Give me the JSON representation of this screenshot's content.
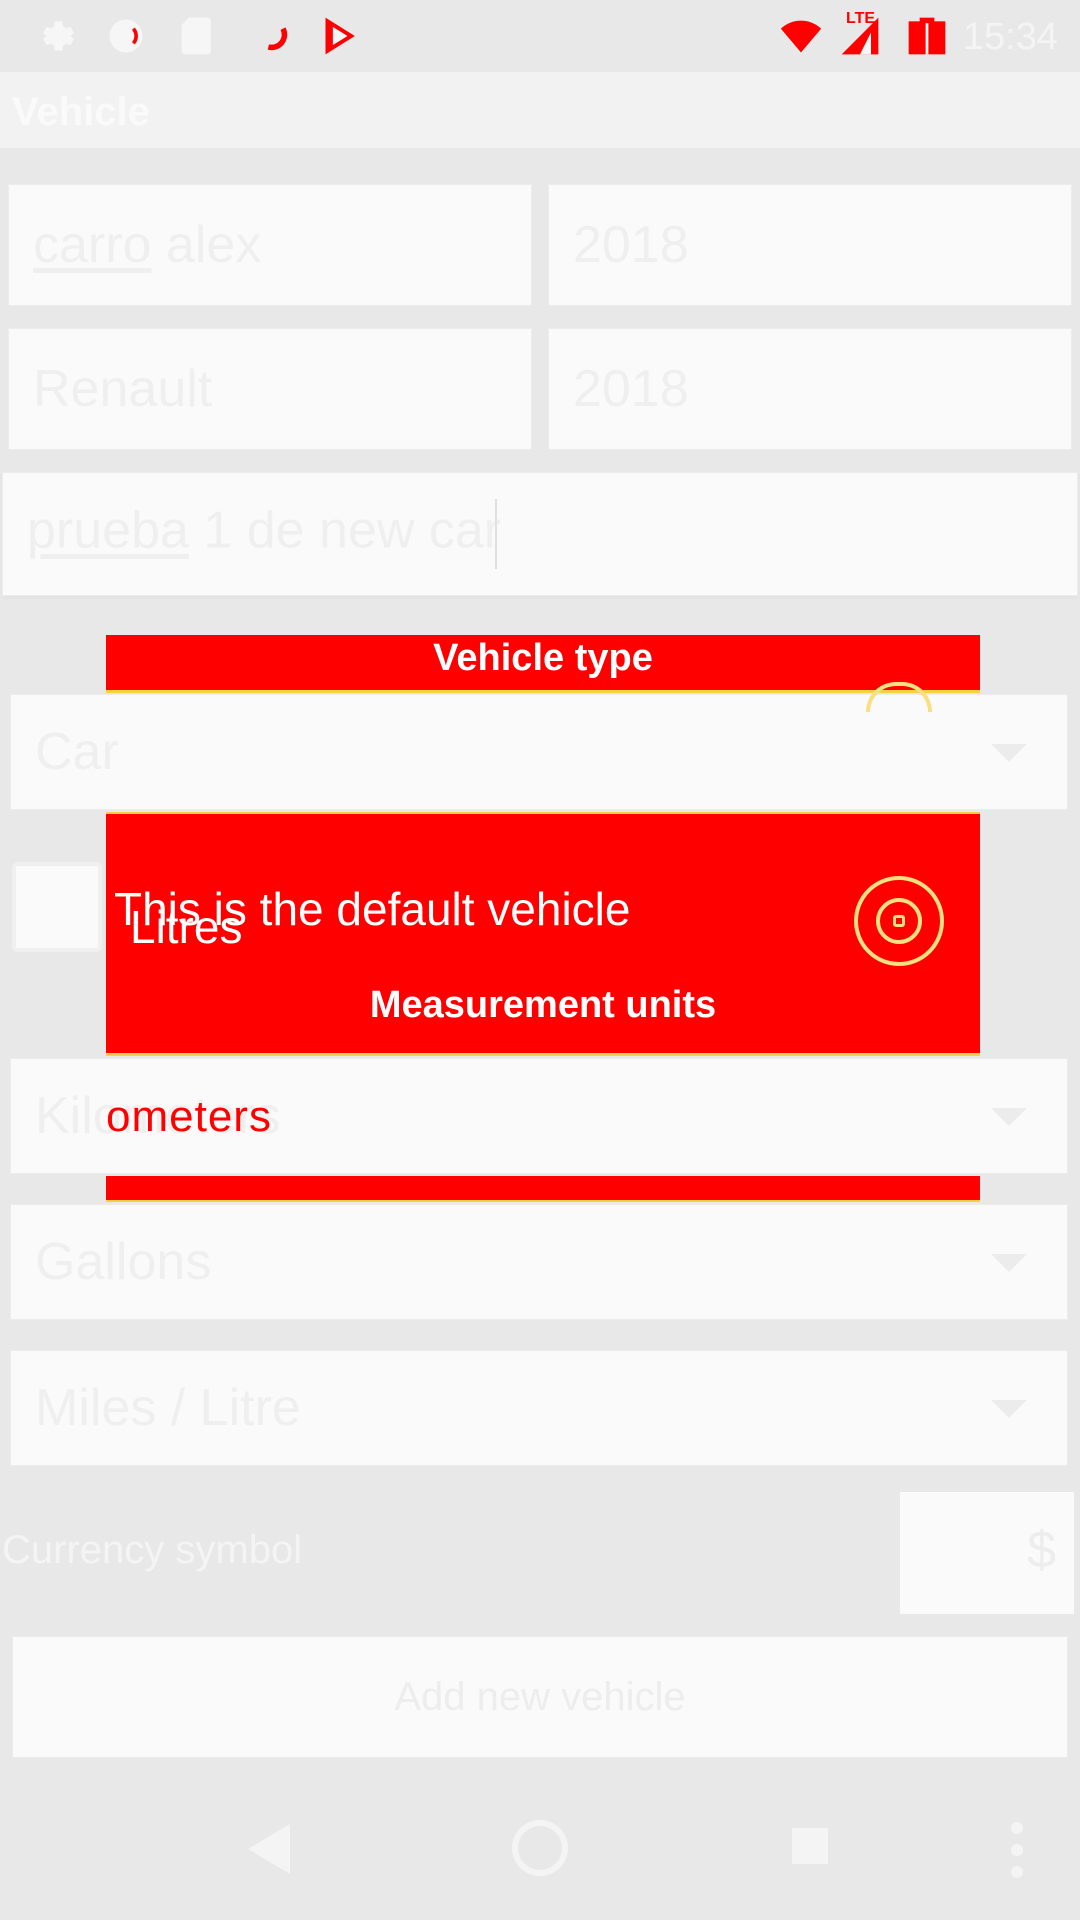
{
  "status_bar": {
    "time": "15:34",
    "network_label": "LTE",
    "icons": [
      "gear-icon",
      "circle-icon",
      "sd-card-icon",
      "sync-icon",
      "play-store-icon",
      "wifi-icon",
      "signal-icon",
      "battery-icon"
    ]
  },
  "appbar": {
    "title": "Vehicle"
  },
  "form": {
    "name": "carro alex",
    "name_underlined": "carro",
    "name_rest": " alex",
    "year_a": "2018",
    "make": "Renault",
    "year_b": "2018",
    "notes_underlined": "prueba",
    "notes_rest": " 1 de new car",
    "vehicle_type": "Car",
    "distance_unit": "Kilometers",
    "fuel_unit": "Gallons",
    "consumption_unit": "Miles / Litre",
    "currency_label": "Currency symbol",
    "currency_value": "$",
    "add_button": "Add new vehicle"
  },
  "dialog": {
    "title": "Vehicle type",
    "default_text": "This is the default vehicle",
    "section_title": "Measurement units",
    "litres": "Litres",
    "km_overlay": "ometers"
  },
  "colors": {
    "accent": "#ff0000",
    "highlight": "#f8d040"
  }
}
